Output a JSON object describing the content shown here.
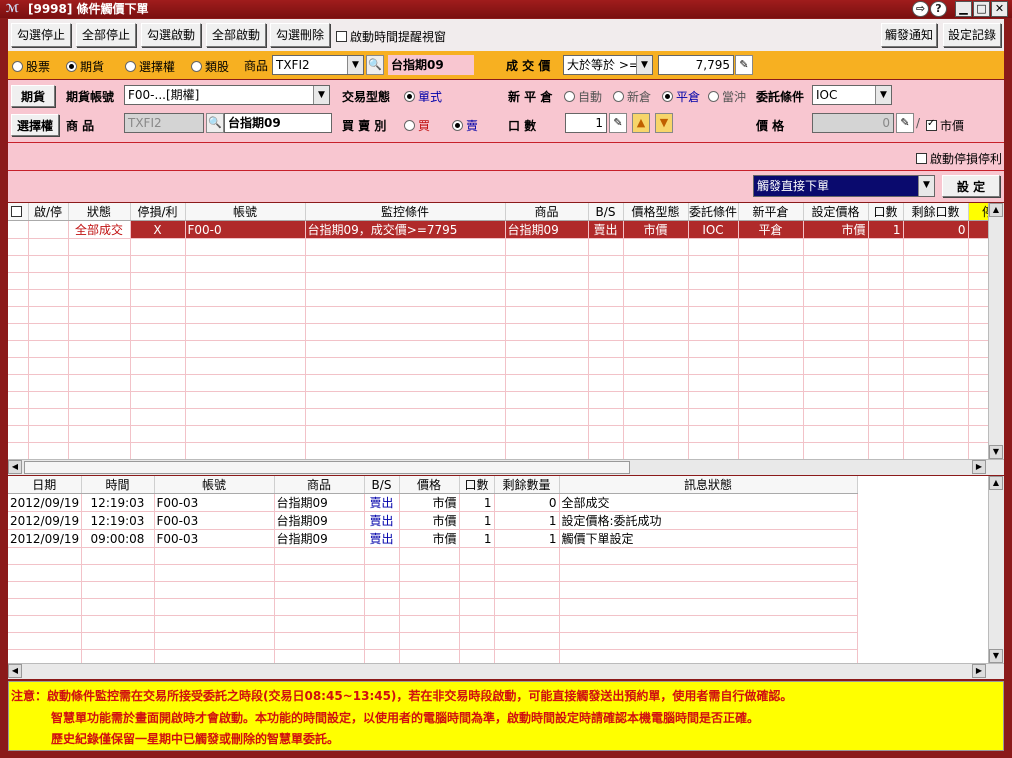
{
  "window": {
    "title": "[9998] 條件觸價下單",
    "logo": "ℳ"
  },
  "toolbar": {
    "stop_checked": "勾選停止",
    "stop_all": "全部停止",
    "start_checked": "勾選啟動",
    "start_all": "全部啟動",
    "delete_checked": "勾選刪除",
    "time_reminder": "啟動時間提醒視窗",
    "trigger_notify": "觸發通知",
    "settings_log": "設定記錄"
  },
  "condition": {
    "types": [
      "股票",
      "期貨",
      "選擇權",
      "類股"
    ],
    "product_label": "商品",
    "product_code": "TXFI2",
    "product_name": "台指期09",
    "price_label": "成 交 價",
    "operator": "大於等於 >=",
    "price_value": "7,795"
  },
  "order": {
    "futures_button": "期貨",
    "options_button": "選擇權",
    "account_label": "期貨帳號",
    "account_value": "F00-...[期權]",
    "trade_type_label": "交易型態",
    "trade_type_value": "單式",
    "offset_label": "新 平 倉",
    "offset_options": [
      "自動",
      "新倉",
      "平倉",
      "當沖"
    ],
    "tif_label": "委託條件",
    "tif_value": "IOC",
    "product_label": "商 品",
    "product_code": "TXFI2",
    "product_name": "台指期09",
    "side_label": "買 賣 別",
    "side_buy": "買",
    "side_sell": "賣",
    "qty_label": "口 數",
    "qty_value": "1",
    "price_label": "價 格",
    "price_value": "0",
    "market_label": "市價",
    "stop_loss_label": "啟動停損停利",
    "mode_value": "觸發直接下單",
    "set_button": "設 定"
  },
  "monitor_table": {
    "headers": [
      "啟/停",
      "狀態",
      "停損/利",
      "帳號",
      "監控條件",
      "商品",
      "B/S",
      "價格型態",
      "委託條件",
      "新平倉",
      "設定價格",
      "口數",
      "剩餘口數",
      "停"
    ],
    "rows": [
      [
        "",
        "全部成交",
        "X",
        "F00-0",
        "台指期09，成交價>=7795",
        "台指期09",
        "賣出",
        "市價",
        "IOC",
        "平倉",
        "市價",
        "1",
        "0",
        ""
      ]
    ]
  },
  "history_table": {
    "headers": [
      "日期",
      "時間",
      "帳號",
      "商品",
      "B/S",
      "價格",
      "口數",
      "剩餘數量",
      "訊息狀態"
    ],
    "rows": [
      [
        "2012/09/19",
        "12:19:03",
        "F00-03",
        "台指期09",
        "賣出",
        "市價",
        "1",
        "0",
        "全部成交"
      ],
      [
        "2012/09/19",
        "12:19:03",
        "F00-03",
        "台指期09",
        "賣出",
        "市價",
        "1",
        "1",
        "設定價格:委託成功"
      ],
      [
        "2012/09/19",
        "09:00:08",
        "F00-03",
        "台指期09",
        "賣出",
        "市價",
        "1",
        "1",
        "觸價下單設定"
      ]
    ]
  },
  "notice": {
    "line1": "注意：啟動條件監控需在交易所接受委託之時段(交易日08:45~13:45)，若在非交易時段啟動，可能直接觸發送出預約單，使用者需自行做確認。",
    "line2": "智慧單功能需於畫面開啟時才會啟動。本功能的時間設定，以使用者的電腦時間為準，啟動時間設定時請確認本機電腦時間是否正確。",
    "line3": "歷史紀錄僅保留一星期中已觸發或刪除的智慧單委託。"
  }
}
